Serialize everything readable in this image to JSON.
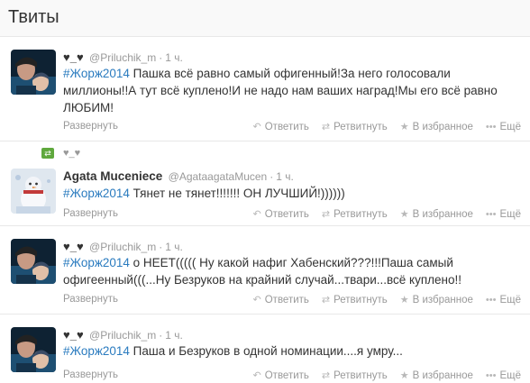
{
  "header": {
    "title": "Твиты"
  },
  "actions": {
    "expand": "Развернуть",
    "reply": "Ответить",
    "retweet": "Ретвитнуть",
    "favorite": "В избранное",
    "more": "Ещё"
  },
  "tweets": [
    {
      "fullname": "♥_♥",
      "username": "@Priluchik_m",
      "time": "1 ч.",
      "hashtag": "#Жорж2014",
      "text": " Пашка всё равно самый офигенный!За него голосовали миллионы!!А тут всё куплено!И не надо нам ваших наград!Мы его всё равно ЛЮБИМ!"
    },
    {
      "retweeted_by": "♥_♥",
      "fullname": "Agata Muceniece",
      "username": "@AgataagataMucen",
      "time": "1 ч.",
      "hashtag": "#Жорж2014",
      "text": " Тянет не тянет!!!!!!! ОН ЛУЧШИЙ!))))))"
    },
    {
      "fullname": "♥_♥",
      "username": "@Priluchik_m",
      "time": "1 ч.",
      "hashtag": "#Жорж2014",
      "text": " о НЕЕТ((((( Ну какой нафиг Хабенский???!!!Паша самый офигеенный(((...Ну Безруков на крайний случай...твари...всё куплено!!"
    },
    {
      "fullname": "♥_♥",
      "username": "@Priluchik_m",
      "time": "1 ч.",
      "hashtag": "#Жорж2014",
      "text": " Паша и Безруков в одной номинации....я умру..."
    }
  ]
}
